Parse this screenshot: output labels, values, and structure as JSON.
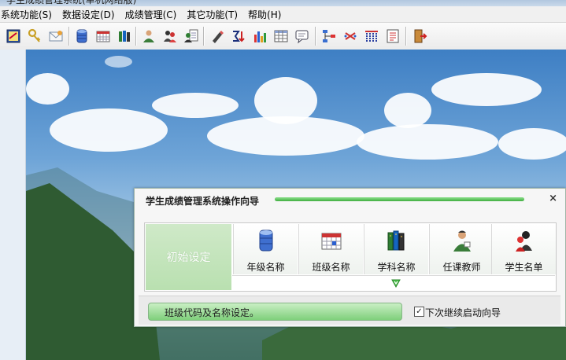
{
  "window": {
    "title": "学生成绩管理系统(单机网络版)"
  },
  "menu": [
    {
      "label": "系统功能(S)"
    },
    {
      "label": "数据设定(D)"
    },
    {
      "label": "成绩管理(C)"
    },
    {
      "label": "其它功能(T)"
    },
    {
      "label": "帮助(H)"
    }
  ],
  "toolbar_icons": [
    "notebook-icon",
    "keys-icon",
    "envelope-icon",
    "database-icon",
    "class-table-icon",
    "books-icon",
    "teacher-icon",
    "students-icon",
    "student-report-icon",
    "edit-pen-icon",
    "sum-sort-icon",
    "bar-chart-icon",
    "grid-table-icon",
    "message-icon",
    "org-chart-icon",
    "random-icon",
    "columns-icon",
    "report-list-icon",
    "exit-door-icon"
  ],
  "wizard": {
    "title": "学生成绩管理系统操作向导",
    "close": "×",
    "progress": 1.0,
    "first_step": "初始设定",
    "steps": [
      {
        "label": "年级名称",
        "icon": "database-icon"
      },
      {
        "label": "班级名称",
        "icon": "class-calendar-icon"
      },
      {
        "label": "学科名称",
        "icon": "books-icon"
      },
      {
        "label": "任课教师",
        "icon": "teacher-icon"
      },
      {
        "label": "学生名单",
        "icon": "students-icon"
      }
    ],
    "status_text": "班级代码及名称设定。",
    "checkbox_label": "下次继续启动向导",
    "checkbox_checked": true,
    "accent_color": "#6cc46a"
  }
}
